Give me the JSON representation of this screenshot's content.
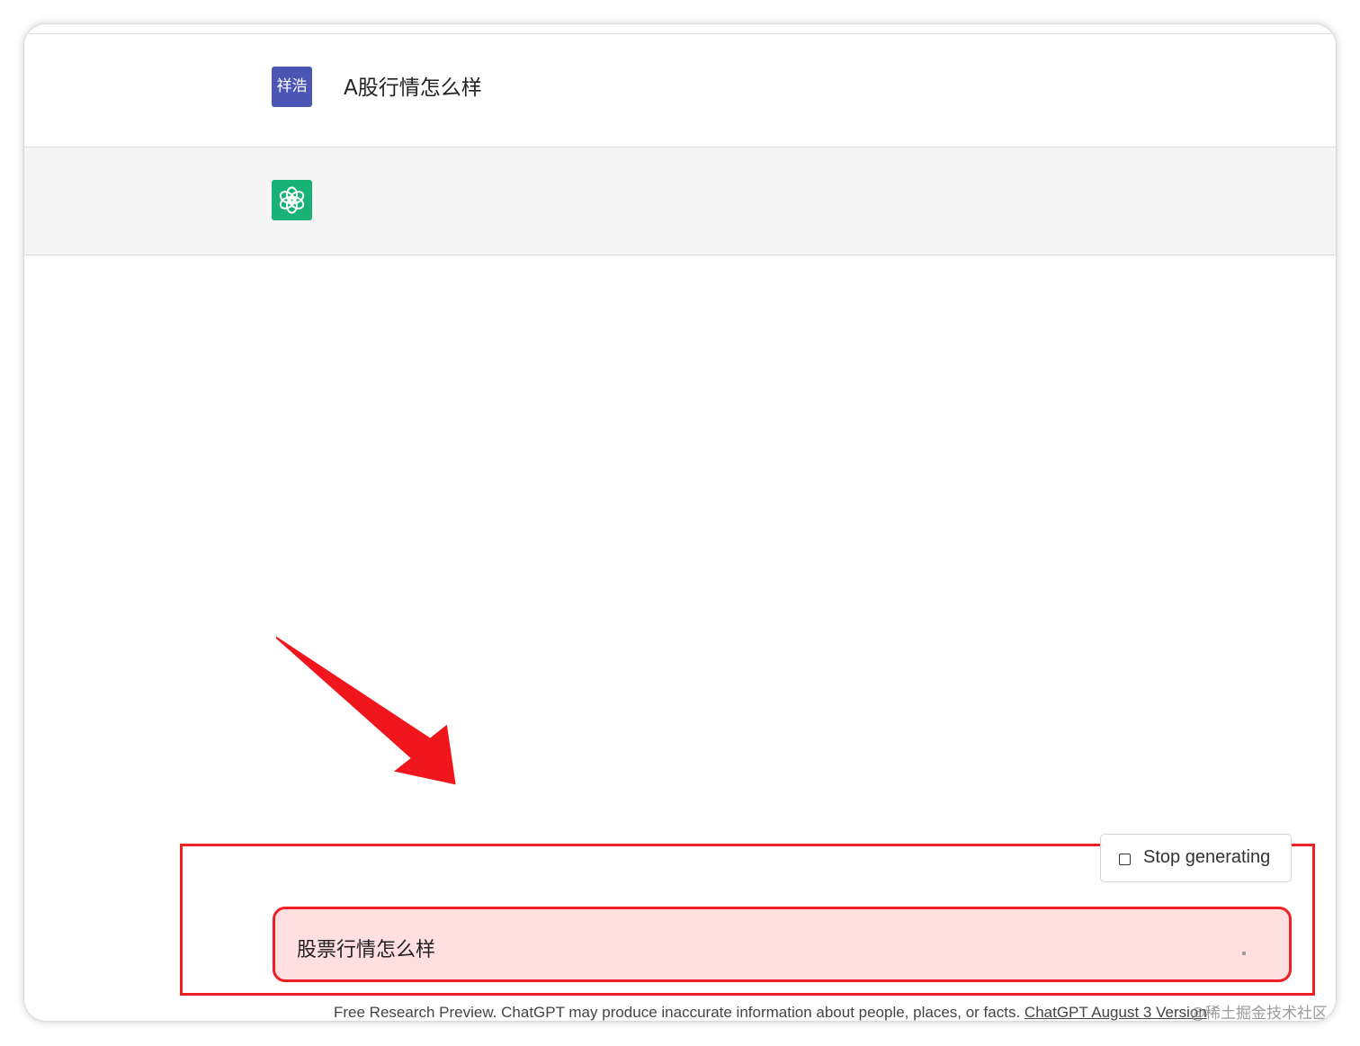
{
  "conversation": {
    "user_message": {
      "avatar_text": "祥浩",
      "text": "A股行情怎么样",
      "avatar_color": "#4b55b3"
    },
    "assistant_message": {
      "avatar_icon": "openai-logo-icon",
      "avatar_color": "#19b276",
      "text": ""
    }
  },
  "controls": {
    "stop_label": "Stop generating",
    "stop_icon": "stop-square-icon"
  },
  "composer": {
    "value": "股票行情怎么样"
  },
  "footer": {
    "text": "Free Research Preview. ChatGPT may produce inaccurate information about people, places, or facts.",
    "link_text": "ChatGPT August 3 Version"
  },
  "annotation": {
    "highlight_color": "#ef1f23",
    "arrow_icon": "red-arrow-icon"
  },
  "watermark": "@稀土掘金技术社区"
}
